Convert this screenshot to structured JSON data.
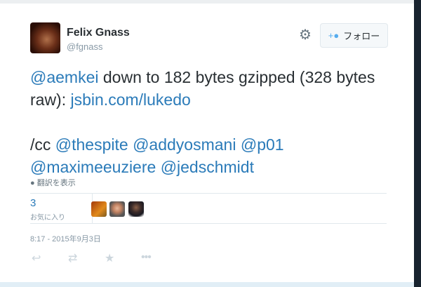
{
  "user": {
    "name": "Felix Gnass",
    "handle": "@fgnass"
  },
  "follow_label": "フォロー",
  "tweet": {
    "parts": [
      {
        "t": "@aemkei",
        "link": true
      },
      {
        "t": " down to 182 bytes gzipped (328 bytes raw): ",
        "link": false
      },
      {
        "t": "jsbin.com/lukedo",
        "link": true
      },
      {
        "br": true
      },
      {
        "br": true
      },
      {
        "t": "/cc ",
        "link": false
      },
      {
        "t": "@thespite",
        "link": true
      },
      {
        "t": " ",
        "link": false
      },
      {
        "t": "@addyosmani",
        "link": true
      },
      {
        "t": " ",
        "link": false
      },
      {
        "t": "@p01",
        "link": true
      },
      {
        "t": " ",
        "link": false
      },
      {
        "t": "@maximeeuziere",
        "link": true
      },
      {
        "t": " ",
        "link": false
      },
      {
        "t": "@jedschmidt",
        "link": true
      }
    ]
  },
  "translate_label": "翻訳を表示",
  "favorites": {
    "count": "3",
    "label": "お気に入り"
  },
  "timestamp": "8:17 - 2015年9月3日",
  "colors": {
    "link": "#2b7bb9",
    "accent": "#55acee"
  }
}
